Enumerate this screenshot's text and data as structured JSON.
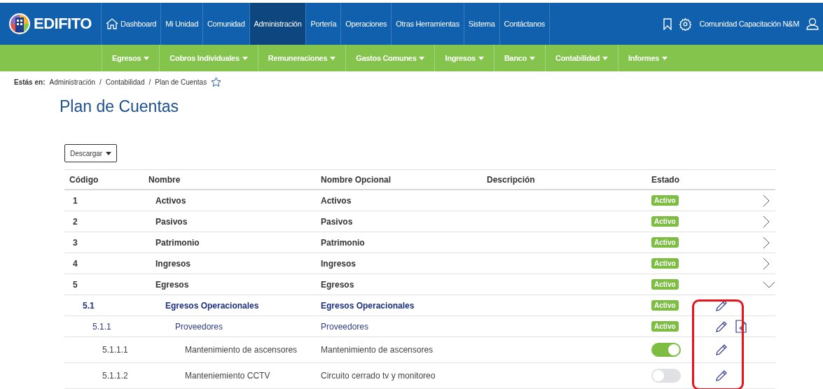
{
  "brand": {
    "name": "EDIFITO"
  },
  "main_nav": [
    {
      "label": "Dashboard",
      "selected": false
    },
    {
      "label": "Mi Unidad",
      "selected": false
    },
    {
      "label": "Comunidad",
      "selected": false
    },
    {
      "label": "Administración",
      "selected": true
    },
    {
      "label": "Portería",
      "selected": false
    },
    {
      "label": "Operaciones",
      "selected": false
    },
    {
      "label": "Otras Herramientas",
      "selected": false
    },
    {
      "label": "Sistema",
      "selected": false
    },
    {
      "label": "Contáctanos",
      "selected": false
    }
  ],
  "user": {
    "name": "Comunidad Capacitación N&M"
  },
  "sub_nav": [
    "Egresos",
    "Cobros Individuales",
    "Remuneraciones",
    "Gastos Comunes",
    "Ingresos",
    "Banco",
    "Contabilidad",
    "Informes"
  ],
  "breadcrumb": {
    "label": "Estás en:",
    "items": [
      "Administración",
      "Contabilidad",
      "Plan de Cuentas"
    ],
    "separator": "/"
  },
  "page_title": "Plan de Cuentas",
  "download_button": "Descargar",
  "table": {
    "columns": [
      "Código",
      "Nombre",
      "Nombre Opcional",
      "Descripción",
      "Estado"
    ],
    "highlight_actions": true,
    "rows": [
      {
        "code": "1",
        "name": "Activos",
        "optional_name": "Activos",
        "status": {
          "kind": "badge",
          "label": "Activo"
        },
        "expanded": false
      },
      {
        "code": "2",
        "name": "Pasivos",
        "optional_name": "Pasivos",
        "status": {
          "kind": "badge",
          "label": "Activo"
        },
        "expanded": false
      },
      {
        "code": "3",
        "name": "Patrimonio",
        "optional_name": "Patrimonio",
        "status": {
          "kind": "badge",
          "label": "Activo"
        },
        "expanded": false
      },
      {
        "code": "4",
        "name": "Ingresos",
        "optional_name": "Ingresos",
        "status": {
          "kind": "badge",
          "label": "Activo"
        },
        "expanded": false
      },
      {
        "code": "5",
        "name": "Egresos",
        "optional_name": "Egresos",
        "status": {
          "kind": "badge",
          "label": "Activo"
        },
        "expanded": true,
        "children": [
          {
            "code": "5.1",
            "name": "Egresos Operacionales",
            "optional_name": "Egresos Operacionales",
            "status": {
              "kind": "badge",
              "label": "Activo"
            },
            "editable": true,
            "can_add_child": false,
            "children": [
              {
                "code": "5.1.1",
                "name": "Proveedores",
                "optional_name": "Proveedores",
                "status": {
                  "kind": "badge",
                  "label": "Activo"
                },
                "editable": true,
                "can_add_child": true,
                "children": [
                  {
                    "code": "5.1.1.1",
                    "name": "Mantenimiento de ascensores",
                    "optional_name": "Mantenimiento de ascensores",
                    "status": {
                      "kind": "toggle",
                      "on": true
                    },
                    "editable": true,
                    "can_add_child": false
                  },
                  {
                    "code": "5.1.1.2",
                    "name": "Manteniemiento CCTV",
                    "optional_name": "Circuito cerrado tv y monitoreo",
                    "status": {
                      "kind": "toggle",
                      "on": false
                    },
                    "editable": true,
                    "can_add_child": false
                  }
                ]
              }
            ]
          }
        ]
      }
    ]
  }
}
